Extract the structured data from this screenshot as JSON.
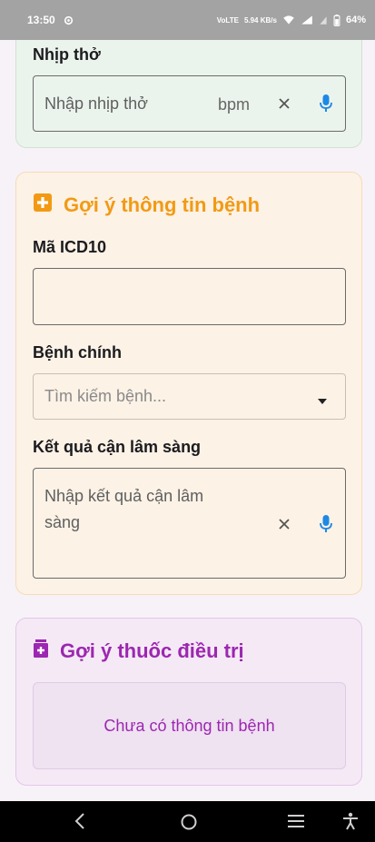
{
  "status_bar": {
    "time": "13:50",
    "network_speed": "5.94 KB/s",
    "network_type": "VoLTE",
    "battery": "64%"
  },
  "vitals_card": {
    "breath_label": "Nhịp thở",
    "breath_placeholder": "Nhập nhịp thở",
    "breath_unit": "bpm"
  },
  "disease_card": {
    "title": "Gợi ý thông tin bệnh",
    "icd_label": "Mã ICD10",
    "icd_value": "",
    "main_disease_label": "Bệnh chính",
    "main_disease_placeholder": "Tìm kiếm bệnh...",
    "lab_result_label": "Kết quả cận lâm sàng",
    "lab_result_placeholder_line1": "Nhập kết quả cận lâm",
    "lab_result_placeholder_line2": "sàng"
  },
  "medicine_card": {
    "title": "Gợi ý thuốc điều trị",
    "empty_message": "Chưa có thông tin bệnh"
  },
  "colors": {
    "orange_accent": "#f29a14",
    "purple_accent": "#9c27b0",
    "mic_blue": "#1e88e5"
  }
}
